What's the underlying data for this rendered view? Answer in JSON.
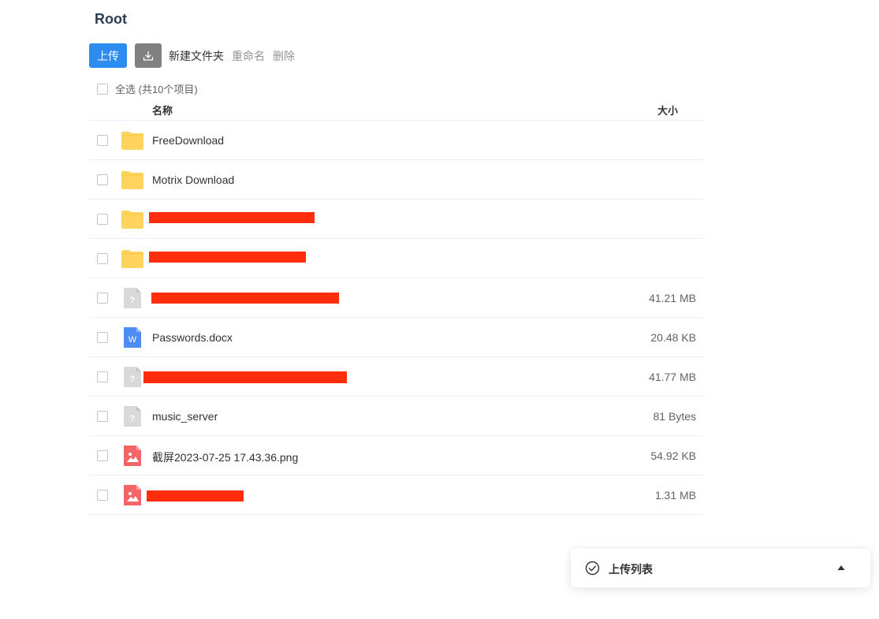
{
  "header": {
    "title": "Root"
  },
  "toolbar": {
    "upload_label": "上传",
    "download_icon": "download-icon",
    "new_folder_label": "新建文件夹",
    "rename_label": "重命名",
    "delete_label": "删除"
  },
  "select_all": {
    "label": "全选 (共10个项目)"
  },
  "table": {
    "columns": {
      "name": "名称",
      "size": "大小"
    },
    "rows": [
      {
        "name": "FreeDownload",
        "size": "",
        "type": "folder",
        "redacted": false
      },
      {
        "name": "Motrix Download",
        "size": "",
        "type": "folder",
        "redacted": false
      },
      {
        "name": "",
        "size": "",
        "type": "folder",
        "redacted": true
      },
      {
        "name": "",
        "size": "",
        "type": "folder",
        "redacted": true
      },
      {
        "name": "",
        "size": "41.21 MB",
        "type": "unknown",
        "redacted": true
      },
      {
        "name": "Passwords.docx",
        "size": "20.48 KB",
        "type": "word",
        "redacted": false
      },
      {
        "name": "",
        "size": "41.77 MB",
        "type": "unknown",
        "redacted": true
      },
      {
        "name": "music_server",
        "size": "81 Bytes",
        "type": "unknown",
        "redacted": false
      },
      {
        "name": "截屏2023-07-25 17.43.36.png",
        "size": "54.92 KB",
        "type": "image",
        "redacted": false
      },
      {
        "name": "",
        "size": "1.31 MB",
        "type": "image",
        "redacted": true
      }
    ]
  },
  "upload_panel": {
    "title": "上传列表"
  },
  "colors": {
    "primary": "#2d8cf0",
    "folder": "#ffd45e",
    "unknown_file": "#d9d9d9",
    "word_file": "#4e8df5",
    "image_file": "#f56565",
    "redaction": "#ff2d0b"
  }
}
